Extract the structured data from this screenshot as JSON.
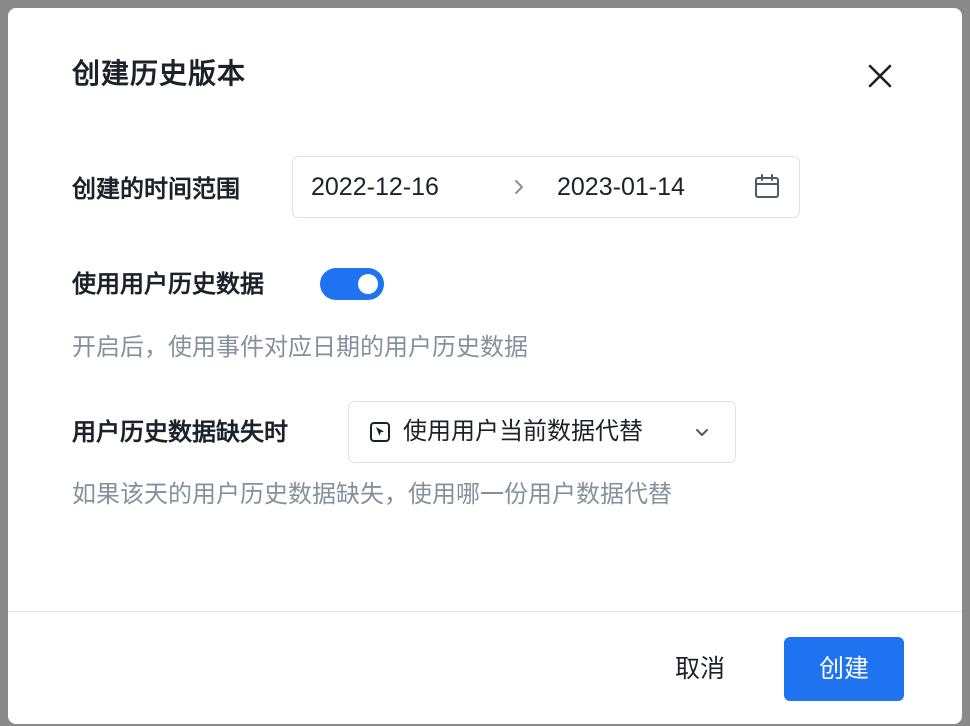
{
  "dialog": {
    "title": "创建历史版本",
    "close_icon": "close-icon"
  },
  "time_range": {
    "label": "创建的时间范围",
    "start": "2022-12-16",
    "end": "2023-01-14",
    "separator_icon": "chevron-right-icon",
    "calendar_icon": "calendar-icon"
  },
  "user_history": {
    "label": "使用用户历史数据",
    "enabled": true,
    "hint": "开启后，使用事件对应日期的用户历史数据"
  },
  "missing_fallback": {
    "label": "用户历史数据缺失时",
    "selected": "使用用户当前数据代替",
    "option_icon": "cursor-box-icon",
    "dropdown_icon": "chevron-down-icon",
    "hint": "如果该天的用户历史数据缺失，使用哪一份用户数据代替"
  },
  "footer": {
    "cancel_label": "取消",
    "create_label": "创建"
  },
  "colors": {
    "primary": "#1f72f0",
    "text": "#1d2129",
    "hint": "#86909c",
    "border": "#e0e2e6"
  }
}
